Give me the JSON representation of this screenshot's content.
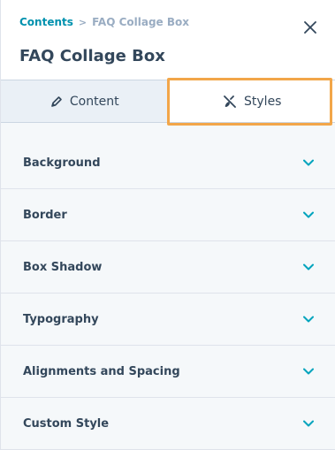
{
  "breadcrumb": {
    "parent": "Contents",
    "separator": ">",
    "current": "FAQ Collage Box"
  },
  "title": "FAQ Collage Box",
  "tabs": [
    {
      "label": "Content",
      "icon": "pencil-icon",
      "active": false
    },
    {
      "label": "Styles",
      "icon": "brush-icon",
      "active": true
    }
  ],
  "sections": [
    {
      "label": "Background"
    },
    {
      "label": "Border"
    },
    {
      "label": "Box Shadow"
    },
    {
      "label": "Typography"
    },
    {
      "label": "Alignments and Spacing"
    },
    {
      "label": "Custom Style"
    }
  ],
  "colors": {
    "accent": "#00a4bd",
    "highlight": "#f2a649",
    "text": "#33475b",
    "link": "#0091ae"
  }
}
